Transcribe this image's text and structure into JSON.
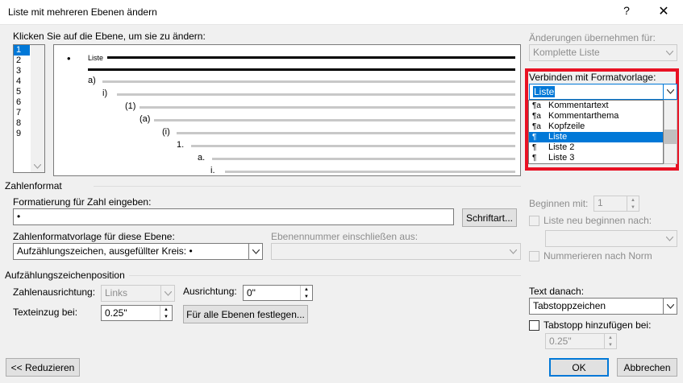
{
  "window": {
    "title": "Liste mit mehreren Ebenen ändern",
    "help_glyph": "?",
    "close_glyph": "✕"
  },
  "levels": {
    "label": "Klicken Sie auf die Ebene, um sie zu ändern:",
    "items": [
      "1",
      "2",
      "3",
      "4",
      "5",
      "6",
      "7",
      "8",
      "9"
    ],
    "selected": "1"
  },
  "preview": {
    "bullet": "•",
    "first_label": "Liste",
    "markers": [
      "a)",
      "i)",
      "(1)",
      "(a)",
      "(i)",
      "1.",
      "a.",
      "i."
    ]
  },
  "apply_changes": {
    "label": "Änderungen übernehmen für:",
    "value": "Komplette Liste"
  },
  "link_style": {
    "label": "Verbinden mit Formatvorlage:",
    "value": "Liste",
    "options": [
      {
        "icon": "¶a",
        "label": "Kommentartext"
      },
      {
        "icon": "¶a",
        "label": "Kommentarthema"
      },
      {
        "icon": "¶a",
        "label": "Kopfzeile"
      },
      {
        "icon": "¶",
        "label": "Liste",
        "selected": true
      },
      {
        "icon": "¶",
        "label": "Liste 2"
      },
      {
        "icon": "¶",
        "label": "Liste 3"
      }
    ]
  },
  "number_format": {
    "group": "Zahlenformat",
    "format_label": "Formatierung für Zahl eingeben:",
    "format_value": "•",
    "font_button": "Schriftart...",
    "style_label": "Zahlenformatvorlage für diese Ebene:",
    "style_value": "Aufzählungszeichen, ausgefüllter Kreis: •",
    "include_label": "Ebenennummer einschließen aus:",
    "include_value": ""
  },
  "right_options": {
    "start_label": "Beginnen mit:",
    "start_value": "1",
    "restart_label": "Liste neu beginnen nach:",
    "restart_value": "",
    "legal_label": "Nummerieren nach Norm"
  },
  "position": {
    "group": "Aufzählungszeichenposition",
    "alignment_label": "Zahlenausrichtung:",
    "alignment_value": "Links",
    "align_at_label": "Ausrichtung:",
    "align_at_value": "0\"",
    "indent_label": "Texteinzug bei:",
    "indent_value": "0.25\"",
    "set_all_button": "Für alle Ebenen festlegen..."
  },
  "follow": {
    "label": "Text danach:",
    "value": "Tabstoppzeichen",
    "tab_add_label": "Tabstopp hinzufügen bei:",
    "tab_value": "0.25\""
  },
  "footer": {
    "less_button": "<< Reduzieren",
    "ok": "OK",
    "cancel": "Abbrechen"
  },
  "colors": {
    "accent": "#0078d7",
    "highlight_box": "#e81123"
  }
}
